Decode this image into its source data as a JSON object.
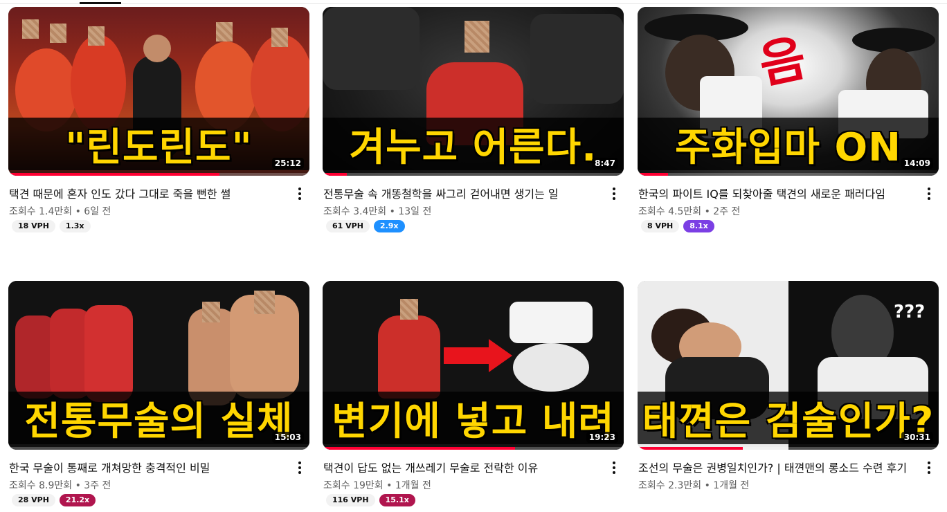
{
  "colors": {
    "progress": "#ff0033",
    "caption_text": "#ffd600",
    "caption_text_alt": "#ffffff"
  },
  "videos": [
    {
      "caption": "\"린도린도\"",
      "duration": "25:12",
      "progress": 0.7,
      "title": "택견 때문에 혼자 인도 갔다 그대로 죽을 뻔한 썰",
      "views": "조회수 1.4만회",
      "age": "6일 전",
      "vph": "18 VPH",
      "ratio": "1.3x",
      "ratio_color": "#f2f2f2",
      "ratio_text_color": "#0f0f0f"
    },
    {
      "caption": "겨누고 어른다.",
      "duration": "8:47",
      "progress": 0.08,
      "title": "전통무술 속 개똥철학을 싸그리 걷어내면 생기는 일",
      "views": "조회수 3.4만회",
      "age": "13일 전",
      "vph": "61 VPH",
      "ratio": "2.9x",
      "ratio_color": "#1e90ff",
      "ratio_text_color": "#ffffff"
    },
    {
      "caption": "주화입마 ON",
      "duration": "14:09",
      "progress": 0.1,
      "title": "한국의 파이트 IQ를 되찾아줄 택견의 새로운 패러다임",
      "views": "조회수 4.5만회",
      "age": "2주 전",
      "vph": "8 VPH",
      "ratio": "8.1x",
      "ratio_color": "#7b3fe4",
      "ratio_text_color": "#ffffff"
    },
    {
      "caption": "전통무술의 실체",
      "duration": "15:03",
      "progress": 0,
      "title": "한국 무술이 통째로 개쳐망한 충격적인 비밀",
      "views": "조회수 8.9만회",
      "age": "3주 전",
      "vph": "28 VPH",
      "ratio": "21.2x",
      "ratio_color": "#b0154e",
      "ratio_text_color": "#ffffff"
    },
    {
      "caption": "변기에 넣고 내려",
      "duration": "19:23",
      "progress": 0.64,
      "title": "택견이 답도 없는 개쓰레기 무술로 전락한 이유",
      "views": "조회수 19만회",
      "age": "1개월 전",
      "vph": "116 VPH",
      "ratio": "15.1x",
      "ratio_color": "#b0154e",
      "ratio_text_color": "#ffffff"
    },
    {
      "caption": "태껸은 검술인가?",
      "duration": "30:31",
      "progress": 0.35,
      "title": "조선의 무술은 권병일치인가? | 태껸맨의 롱소드 수련 후기",
      "views": "조회수 2.3만회",
      "age": "1개월 전",
      "vph": "",
      "ratio": "",
      "ratio_color": "#f2f2f2",
      "ratio_text_color": "#0f0f0f"
    }
  ],
  "thumb_extras": {
    "v3_symbol": "음",
    "v6_symbol": "???"
  }
}
